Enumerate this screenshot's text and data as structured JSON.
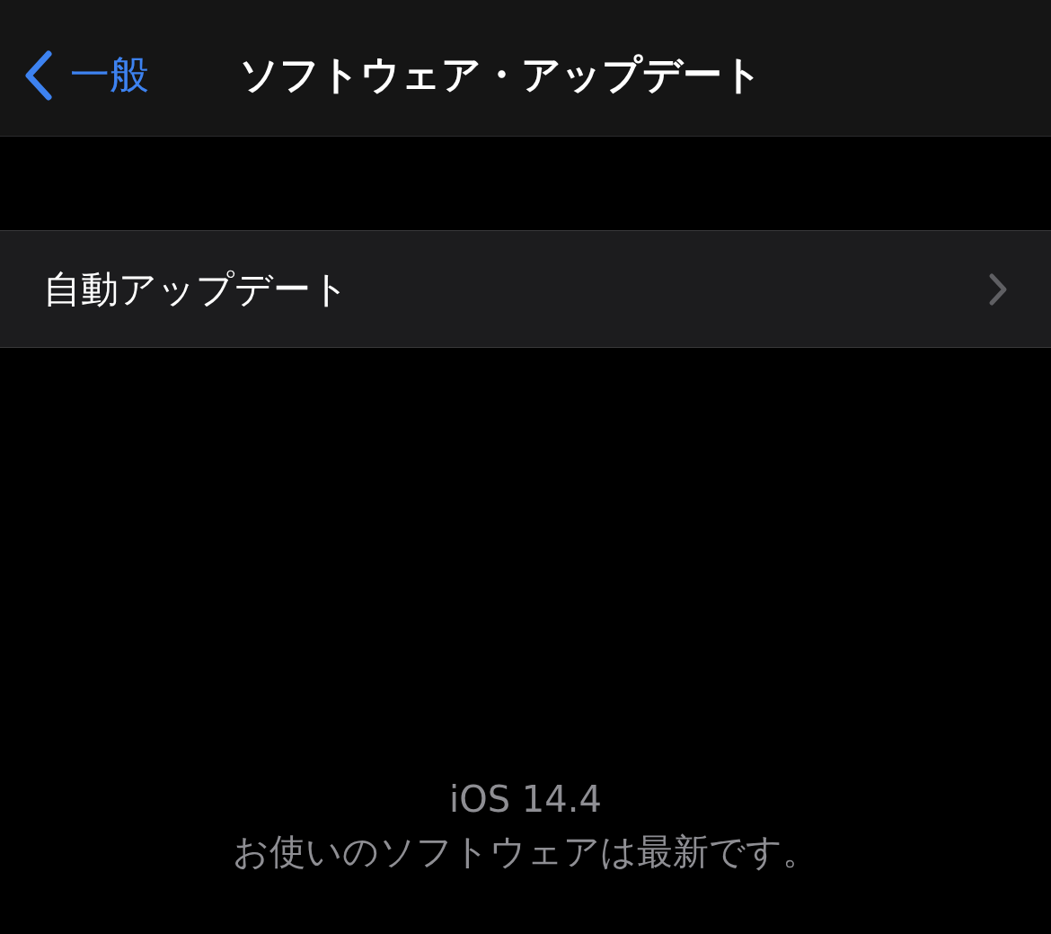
{
  "nav_bar": {
    "back_label": "一般",
    "title": "ソフトウェア・アップデート"
  },
  "rows": [
    {
      "label": "自動アップデート"
    }
  ],
  "footer": {
    "version": "iOS 14.4",
    "status": "お使いのソフトウェアは最新です。"
  }
}
